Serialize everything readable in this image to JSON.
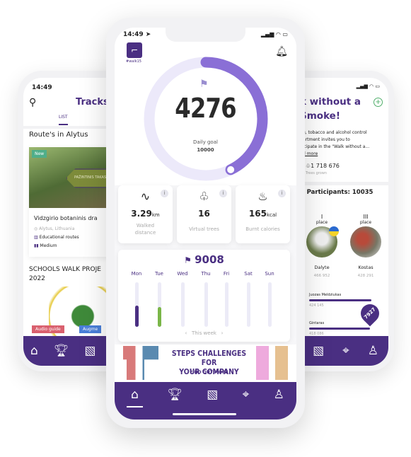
{
  "left_phone": {
    "time": "14:49",
    "title": "Tracks",
    "tab": "LIST",
    "section": "Route's in Alytus",
    "badge_new": "New",
    "sign_text": "PAŽINTINIS TAKAS",
    "route": {
      "name": "Vidzgirio botaninis dra",
      "location": "Alytus, Lithuania",
      "category": "Educational routes",
      "difficulty": "Medium"
    },
    "section2_line1": "SCHOOLS WALK PROJE",
    "section2_line2": "2022",
    "tags": [
      "Audio guide",
      "Augme"
    ]
  },
  "main_phone": {
    "time": "14:49",
    "logo_tag": "#walk15",
    "steps": 4276,
    "steps_text": "4276",
    "goal_label": "Daily goal",
    "goal": "10000",
    "progress": 0.4276,
    "stats": [
      {
        "icon": "route-icon",
        "value": "3.29",
        "unit": "km",
        "label": "Walked distance"
      },
      {
        "icon": "tree-icon",
        "value": "16",
        "unit": "",
        "label": "Virtual trees"
      },
      {
        "icon": "flame-icon",
        "value": "165",
        "unit": "kcal",
        "label": "Burnt calories"
      }
    ],
    "week_total": "9008",
    "days": [
      {
        "label": "Mon",
        "fill": 0.48,
        "color": "#4a2f82"
      },
      {
        "label": "Tue",
        "fill": 0.44,
        "color": "#7ab648"
      },
      {
        "label": "Wed",
        "fill": 0
      },
      {
        "label": "Thu",
        "fill": 0
      },
      {
        "label": "Fri",
        "fill": 0
      },
      {
        "label": "Sat",
        "fill": 0
      },
      {
        "label": "Sun",
        "fill": 0
      }
    ],
    "week_label": "This week",
    "banner_line1": "STEPS CHALLENGES FOR",
    "banner_line2": "YOUR COMPANY",
    "banner_cta": "FIND OUT MORE"
  },
  "right_phone": {
    "title_line1": "k without a",
    "title_line2": "Smoke!",
    "body": [
      "g, tobacco and alcohol control",
      "artment invites you to",
      "icipate in the \"Walk without a...",
      "d more"
    ],
    "trees": "1 718 676",
    "trees_label": "Trees grown",
    "participants": "f Participants: 10035",
    "podium": [
      {
        "place": "I",
        "place_label": "place",
        "name": "Dalyte",
        "score": "466 952"
      },
      {
        "place": "III",
        "place_label": "place",
        "name": "Kostas",
        "score": "428 291"
      }
    ],
    "ranks": [
      {
        "name": "Juozas Meldziukas",
        "score": "424 145"
      },
      {
        "name": "Gintaras",
        "score": "418 086"
      }
    ],
    "my_badge": "7927"
  },
  "colors": {
    "brand": "#4a2f82",
    "ring": "#8a6fd6",
    "ring_track": "#ece9fa",
    "green": "#7ab648"
  }
}
